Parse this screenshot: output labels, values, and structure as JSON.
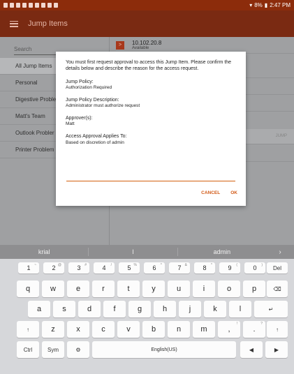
{
  "status_bar": {
    "battery": "8%",
    "time": "2:47 PM"
  },
  "app_bar": {
    "title": "Jump Items"
  },
  "sidebar": {
    "search_placeholder": "Search",
    "items": [
      {
        "label": "All Jump Items"
      },
      {
        "label": "Personal"
      },
      {
        "label": "Digestive Proble"
      },
      {
        "label": "Matt's Team"
      },
      {
        "label": "Outlook Probler"
      },
      {
        "label": "Printer Problem"
      }
    ]
  },
  "jump_list": {
    "first_item": {
      "name": "10.102.20.8",
      "status": "Available"
    },
    "highlight_label": "JUMP"
  },
  "dialog": {
    "intro": "You must first request approval to access this Jump Item. Please confirm the details below and describe the reason for the access request.",
    "policy_label": "Jump Policy:",
    "policy_value": "Authorization Required",
    "desc_label": "Jump Policy Description:",
    "desc_value": "Administrator must authorize request",
    "approver_label": "Approver(s):",
    "approver_value": "Matt",
    "applies_label": "Access Approval Applies To:",
    "applies_value": "Based on discretion of admin",
    "reason_value": "",
    "cancel_label": "CANCEL",
    "ok_label": "OK",
    "accent_color": "#d25b18"
  },
  "keyboard": {
    "suggestions": [
      "krial",
      "l",
      "admin"
    ],
    "more_arrow": "›",
    "row_numbers": [
      {
        "k": "1",
        "s": "~"
      },
      {
        "k": "2",
        "s": "@"
      },
      {
        "k": "3",
        "s": "#"
      },
      {
        "k": "4",
        "s": "/"
      },
      {
        "k": "5",
        "s": "%"
      },
      {
        "k": "6",
        "s": "^"
      },
      {
        "k": "7",
        "s": "&"
      },
      {
        "k": "8",
        "s": "*"
      },
      {
        "k": "9",
        "s": "("
      },
      {
        "k": "0",
        "s": ")"
      }
    ],
    "del_label": "Del",
    "row1": [
      "q",
      "w",
      "e",
      "r",
      "t",
      "y",
      "u",
      "i",
      "o",
      "p"
    ],
    "row2": [
      "a",
      "s",
      "d",
      "f",
      "g",
      "h",
      "j",
      "k",
      "l"
    ],
    "row3": [
      "z",
      "x",
      "c",
      "v",
      "b",
      "n",
      "m",
      ",",
      "."
    ],
    "row3_sups": [
      "",
      "",
      "",
      "",
      "",
      "",
      "",
      "!",
      "?"
    ],
    "ctrl_label": "Ctrl",
    "sym_label": "Sym",
    "space_label": "English(US)"
  }
}
